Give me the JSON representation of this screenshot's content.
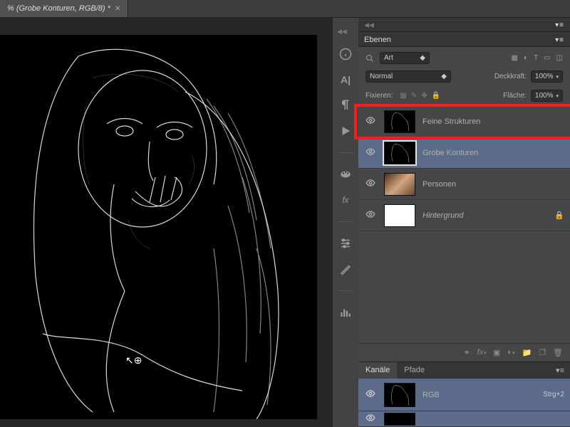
{
  "tab": {
    "title": "% (Grobe Konturen, RGB/8) *"
  },
  "panels": {
    "layers": {
      "title": "Ebenen",
      "filter_label": "Art",
      "blend_mode": "Normal",
      "opacity_label": "Deckkraft:",
      "opacity_value": "100%",
      "lock_label": "Fixieren:",
      "fill_label": "Fläche:",
      "fill_value": "100%",
      "items": [
        {
          "name": "Feine Strukturen",
          "visible": true,
          "selected": false,
          "thumb": "edges",
          "italic": false,
          "locked": false
        },
        {
          "name": "Grobe Konturen",
          "visible": true,
          "selected": true,
          "thumb": "edges",
          "italic": false,
          "locked": false
        },
        {
          "name": "Personen",
          "visible": true,
          "selected": false,
          "thumb": "photo",
          "italic": false,
          "locked": false
        },
        {
          "name": "Hintergrund",
          "visible": true,
          "selected": false,
          "thumb": "white",
          "italic": true,
          "locked": true
        }
      ]
    },
    "channels": {
      "tabs": [
        "Kanäle",
        "Pfade"
      ],
      "items": [
        {
          "name": "RGB",
          "shortcut": "Strg+2"
        }
      ]
    }
  }
}
